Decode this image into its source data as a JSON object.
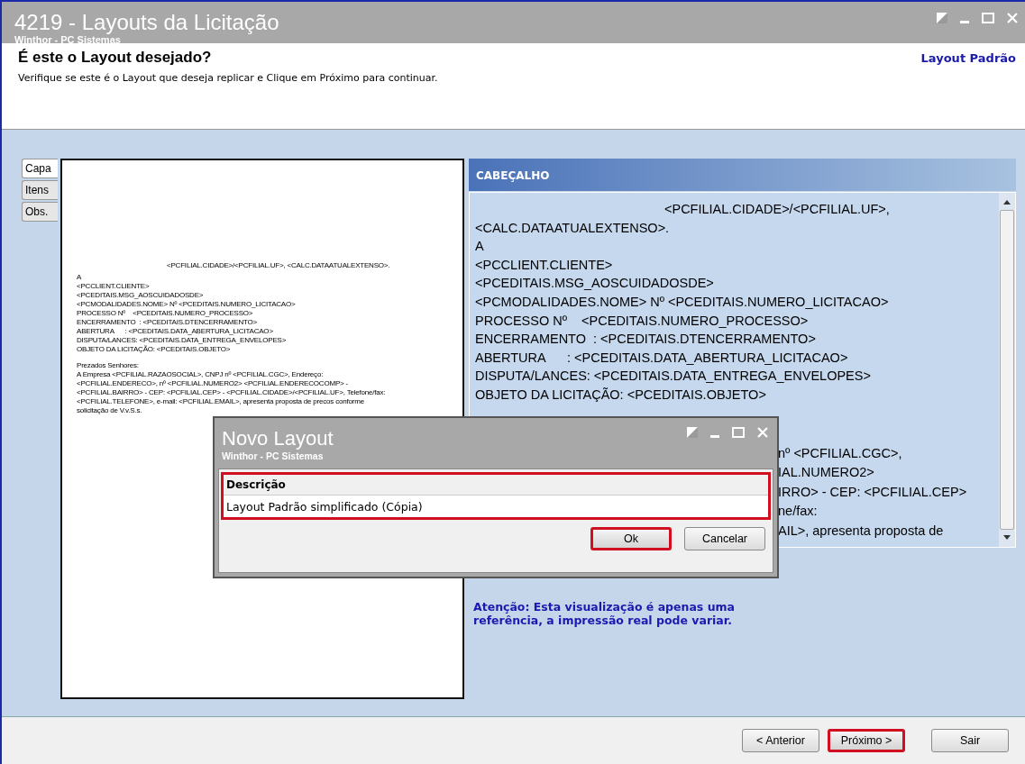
{
  "window": {
    "title": "4219 - Layouts da Licitação",
    "subtitle": "Winthor - PC Sistemas"
  },
  "header": {
    "title": "É este o Layout desejado?",
    "description": "Verifique se este é o Layout que deseja replicar e Clique em Próximo para continuar.",
    "layout_name": "Layout Padrão"
  },
  "tabs": [
    {
      "label": "Capa",
      "selected": true
    },
    {
      "label": "Itens",
      "selected": false
    },
    {
      "label": "Obs.",
      "selected": false
    }
  ],
  "preview_lines": [
    {
      "text": "<PCFILIAL.CIDADE>/<PCFILIAL.UF>, <CALC.DATAATUALEXTENSO>.",
      "kind": "dateline"
    },
    {
      "text": "A",
      "kind": "line"
    },
    {
      "text": "<PCCLIENT.CLIENTE>",
      "kind": "line"
    },
    {
      "text": "<PCEDITAIS.MSG_AOSCUIDADOSDE>",
      "kind": "line"
    },
    {
      "text": "<PCMODALIDADES.NOME> Nº <PCEDITAIS.NUMERO_LICITACAO>",
      "kind": "line"
    },
    {
      "text": "PROCESSO Nº    <PCEDITAIS.NUMERO_PROCESSO>",
      "kind": "line"
    },
    {
      "text": "ENCERRAMENTO  : <PCEDITAIS.DTENCERRAMENTO>",
      "kind": "line"
    },
    {
      "text": "ABERTURA      : <PCEDITAIS.DATA_ABERTURA_LICITACAO>",
      "kind": "line"
    },
    {
      "text": "DISPUTA/LANCES: <PCEDITAIS.DATA_ENTREGA_ENVELOPES>",
      "kind": "line"
    },
    {
      "text": "OBJETO DA LICITAÇÃO: <PCEDITAIS.OBJETO>",
      "kind": "line"
    },
    {
      "text": "Prezados Senhores:",
      "kind": "para"
    },
    {
      "text": "A Empresa <PCFILIAL.RAZAOSOCIAL>, CNPJ nº <PCFILIAL.CGC>, Endereço:",
      "kind": "line"
    },
    {
      "text": "<PCFILIAL.ENDERECO>, nº <PCFILIAL.NUMERO2> <PCFILIAL.ENDERECOCOMP> -",
      "kind": "line"
    },
    {
      "text": "<PCFILIAL.BAIRRO> - CEP: <PCFILIAL.CEP> - <PCFILIAL.CIDADE>/<PCFILIAL.UF>, Telefone/fax:",
      "kind": "line"
    },
    {
      "text": "<PCFILIAL.TELEFONE>, e-mail: <PCFILIAL.EMAIL>, apresenta proposta de precos conforme",
      "kind": "line"
    },
    {
      "text": "solicitação de V.v.S.s.",
      "kind": "line"
    }
  ],
  "section": {
    "title": "CABEÇALHO",
    "lines": [
      {
        "text": "<PCFILIAL.CIDADE>/<PCFILIAL.UF>,",
        "kind": "dateline"
      },
      {
        "text": "<CALC.DATAATUALEXTENSO>.",
        "kind": "line"
      },
      {
        "text": "A",
        "kind": "line"
      },
      {
        "text": "<PCCLIENT.CLIENTE>",
        "kind": "line"
      },
      {
        "text": "<PCEDITAIS.MSG_AOSCUIDADOSDE>",
        "kind": "line"
      },
      {
        "text": "<PCMODALIDADES.NOME> Nº <PCEDITAIS.NUMERO_LICITACAO>",
        "kind": "line"
      },
      {
        "text": "PROCESSO Nº    <PCEDITAIS.NUMERO_PROCESSO>",
        "kind": "line"
      },
      {
        "text": "ENCERRAMENTO  : <PCEDITAIS.DTENCERRAMENTO>",
        "kind": "line"
      },
      {
        "text": "ABERTURA      : <PCEDITAIS.DATA_ABERTURA_LICITACAO>",
        "kind": "line"
      },
      {
        "text": "DISPUTA/LANCES: <PCEDITAIS.DATA_ENTREGA_ENVELOPES>",
        "kind": "line"
      },
      {
        "text": "OBJETO DA LICITAÇÃO: <PCEDITAIS.OBJETO>",
        "kind": "line"
      },
      {
        "text": "nº <PCFILIAL.CGC>,",
        "kind": "cut"
      },
      {
        "text": "IAL.NUMERO2>",
        "kind": "cut"
      },
      {
        "text": "IRRO> - CEP: <PCFILIAL.CEP>",
        "kind": "cut"
      },
      {
        "text": "ne/fax:",
        "kind": "cut"
      },
      {
        "text": "AIL>, apresenta proposta de",
        "kind": "cut"
      }
    ]
  },
  "notice": "Atenção: Esta visualização é apenas uma referência, a impressão real pode variar.",
  "buttons": [
    {
      "label": "< Anterior",
      "highlighted": false
    },
    {
      "label": "Próximo >",
      "highlighted": true
    },
    {
      "label": "Sair",
      "highlighted": false
    }
  ],
  "dialog": {
    "title": "Novo Layout",
    "subtitle": "Winthor - PC Sistemas",
    "field_label": "Descrição",
    "value": "Layout Padrão simplificado (Cópia)",
    "field_highlighted": true,
    "buttons": [
      {
        "label": "Ok",
        "highlighted": true
      },
      {
        "label": "Cancelar",
        "highlighted": false
      }
    ]
  }
}
